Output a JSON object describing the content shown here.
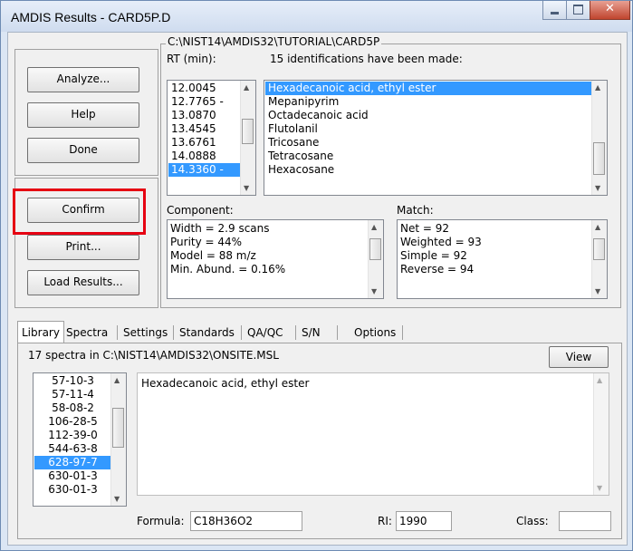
{
  "window": {
    "title": "AMDIS Results - CARD5P.D",
    "controls": [
      "minimize",
      "maximize",
      "close"
    ]
  },
  "group_path": "C:\\NIST14\\AMDIS32\\TUTORIAL\\CARD5P",
  "buttons": {
    "analyze": "Analyze...",
    "help": "Help",
    "done": "Done",
    "confirm": "Confirm",
    "print": "Print...",
    "load_results": "Load Results..."
  },
  "rt": {
    "label": "RT (min):",
    "items": [
      "12.0045",
      "12.7765 -",
      "13.0870",
      "13.4545",
      "13.6761",
      "14.0888",
      "14.3360 -"
    ],
    "selected_index": 6
  },
  "identifications": {
    "label": "15 identifications have been made:",
    "items": [
      "Hexadecanoic acid, ethyl ester",
      "Mepanipyrim",
      "Octadecanoic acid",
      "Flutolanil",
      "Tricosane",
      "Tetracosane",
      "Hexacosane"
    ],
    "selected_index": 0
  },
  "component": {
    "label": "Component:",
    "lines": [
      "Width = 2.9 scans",
      "Purity = 44%",
      "Model = 88 m/z",
      "Min. Abund. = 0.16%"
    ]
  },
  "match": {
    "label": "Match:",
    "lines": [
      "Net = 92",
      "Weighted = 93",
      "Simple = 92",
      "Reverse = 94"
    ]
  },
  "tabs": [
    "Library",
    "Spectra",
    "Settings",
    "Standards",
    "QA/QC",
    "S/N",
    "Options"
  ],
  "selected_tab": "Library",
  "library": {
    "spectra_text": "17 spectra in C:\\NIST14\\AMDIS32\\ONSITE.MSL",
    "view_button": "View",
    "cas_items": [
      "57-10-3",
      "57-11-4",
      "58-08-2",
      "106-28-5",
      "112-39-0",
      "544-63-8",
      "628-97-7",
      "630-01-3",
      "630-01-3"
    ],
    "cas_selected_index": 6,
    "name_text": "Hexadecanoic acid, ethyl ester",
    "formula_label": "Formula:",
    "formula_value": "C18H36O2",
    "ri_label": "RI:",
    "ri_value": "1990",
    "class_label": "Class:",
    "class_value": ""
  },
  "colors": {
    "selection": "#3399ff",
    "highlight_box": "#e60012",
    "close_button": "#c0452f"
  }
}
